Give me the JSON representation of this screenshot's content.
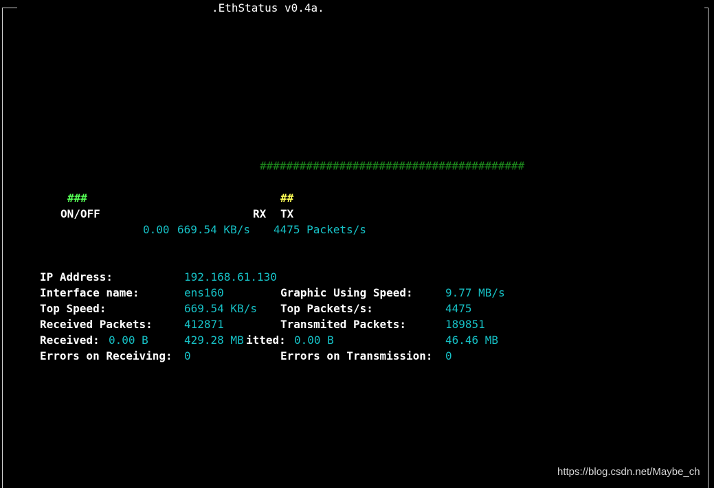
{
  "window": {
    "title": ".EthStatus v0.4a."
  },
  "bar": {
    "hashes": "########################################"
  },
  "indicators": {
    "onoff_mark": "###",
    "onoff_label": "ON/OFF",
    "rx_label": "RX",
    "tx_mark": "##",
    "tx_label": "TX",
    "rate_rx": "0.00",
    "rate_speed": "669.54 KB/s",
    "rate_packets": "4475 Packets/s"
  },
  "stats": {
    "ip_label": "IP Address:",
    "ip_value": "192.168.61.130",
    "iface_label": "Interface name:",
    "iface_value": "ens160",
    "graphic_label": "Graphic Using Speed:",
    "graphic_value": "9.77 MB/s",
    "top_speed_label": "Top Speed:",
    "top_speed_value": "669.54 KB/s",
    "top_packets_label": "Top Packets/s:",
    "top_packets_value": "4475",
    "recv_packets_label": "Received Packets:",
    "recv_packets_value": "412871",
    "trans_packets_label": "Transmited Packets:",
    "trans_packets_value": "189851",
    "received_label": "Received:",
    "received_value": "0.00 B",
    "received_total": "429.28 MB",
    "transmitted_label_tail": "itted:",
    "transmitted_value": "0.00 B",
    "transmitted_total": "46.46 MB",
    "err_recv_label": "Errors on Receiving:",
    "err_recv_value": "0",
    "err_trans_label": "Errors on Transmission:",
    "err_trans_value": "0"
  },
  "watermark": "https://blog.csdn.net/Maybe_ch",
  "colors": {
    "background": "#000000",
    "value_cyan": "#16c0c5",
    "bar_green": "#1c8a1c",
    "onoff_green": "#55ff55",
    "tx_yellow": "#ffff55"
  }
}
